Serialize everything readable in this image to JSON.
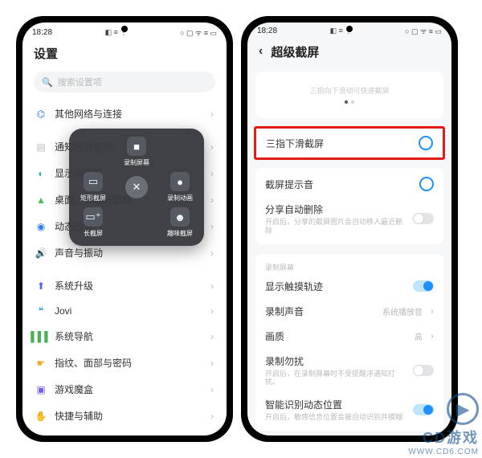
{
  "status": {
    "time": "18:28",
    "left_icons": "◧ ≡ ⋮",
    "right_icons": "○ ▢ ᯤ ≡ ▭"
  },
  "left": {
    "title": "设置",
    "search_placeholder": "搜索设置项",
    "items": [
      {
        "icon": "⌬",
        "cls": "c-blue",
        "label": "其他网络与连接"
      },
      {
        "icon": "▤",
        "cls": "c-grey",
        "label": "通知与状态栏"
      },
      {
        "icon": "◐",
        "cls": "c-teal",
        "label": "显示与亮度"
      },
      {
        "icon": "▲",
        "cls": "c-green",
        "label": "桌面、锁屏与壁纸"
      },
      {
        "icon": "◉",
        "cls": "c-blue",
        "label": "动态效果"
      },
      {
        "icon": "🔊",
        "cls": "c-red",
        "label": "声音与振动"
      },
      {
        "icon": "⬆",
        "cls": "c-indigo",
        "label": "系统升级"
      },
      {
        "icon": "❝",
        "cls": "c-cyan",
        "label": "Jovi"
      },
      {
        "icon": "▌▌▌",
        "cls": "c-lime",
        "label": "系统导航"
      },
      {
        "icon": "☛",
        "cls": "c-orange",
        "label": "指纹、面部与密码"
      },
      {
        "icon": "▣",
        "cls": "c-purple",
        "label": "游戏魔盒"
      },
      {
        "icon": "✋",
        "cls": "c-teal2",
        "label": "快捷与辅助"
      }
    ]
  },
  "panel": {
    "items": [
      {
        "icon_text": "■",
        "label": "录制屏幕"
      },
      {
        "icon_text": "▭",
        "label": "矩形截屏"
      },
      {
        "icon_text": "✕",
        "label": ""
      },
      {
        "icon_text": "●",
        "label": "录制动画"
      },
      {
        "icon_text": "▭⁺",
        "label": "长截屏"
      },
      {
        "icon_text": "☻",
        "label": "趣味截屏"
      }
    ]
  },
  "right": {
    "title": "超级截屏",
    "preview_hint": "三指向下滑动可快速截屏",
    "highlight": {
      "label": "三指下滑截屏"
    },
    "group1": [
      {
        "label": "截屏提示音",
        "control": "ring"
      },
      {
        "label": "分享自动删除",
        "sub": "开启后，分享的截屏图片会自动移入最近删除",
        "control": "switch-off"
      }
    ],
    "group2_title": "录制屏幕",
    "group2": [
      {
        "label": "显示触摸轨迹",
        "control": "switch-on"
      },
      {
        "label": "录制声音",
        "value": "系统播放音",
        "control": "chev"
      },
      {
        "label": "画质",
        "value": "高",
        "control": "chev"
      },
      {
        "label": "录制勿扰",
        "sub": "开启后，在录制屏幕时不受提醒浮通知打扰。",
        "control": "switch-off"
      },
      {
        "label": "智能识别动态位置",
        "sub": "开启后，敏感信息位置会被自动识别并模糊",
        "control": "switch-on"
      }
    ]
  },
  "watermark": {
    "line1": "CD游戏",
    "line2": "WWW.CD6.COM"
  }
}
